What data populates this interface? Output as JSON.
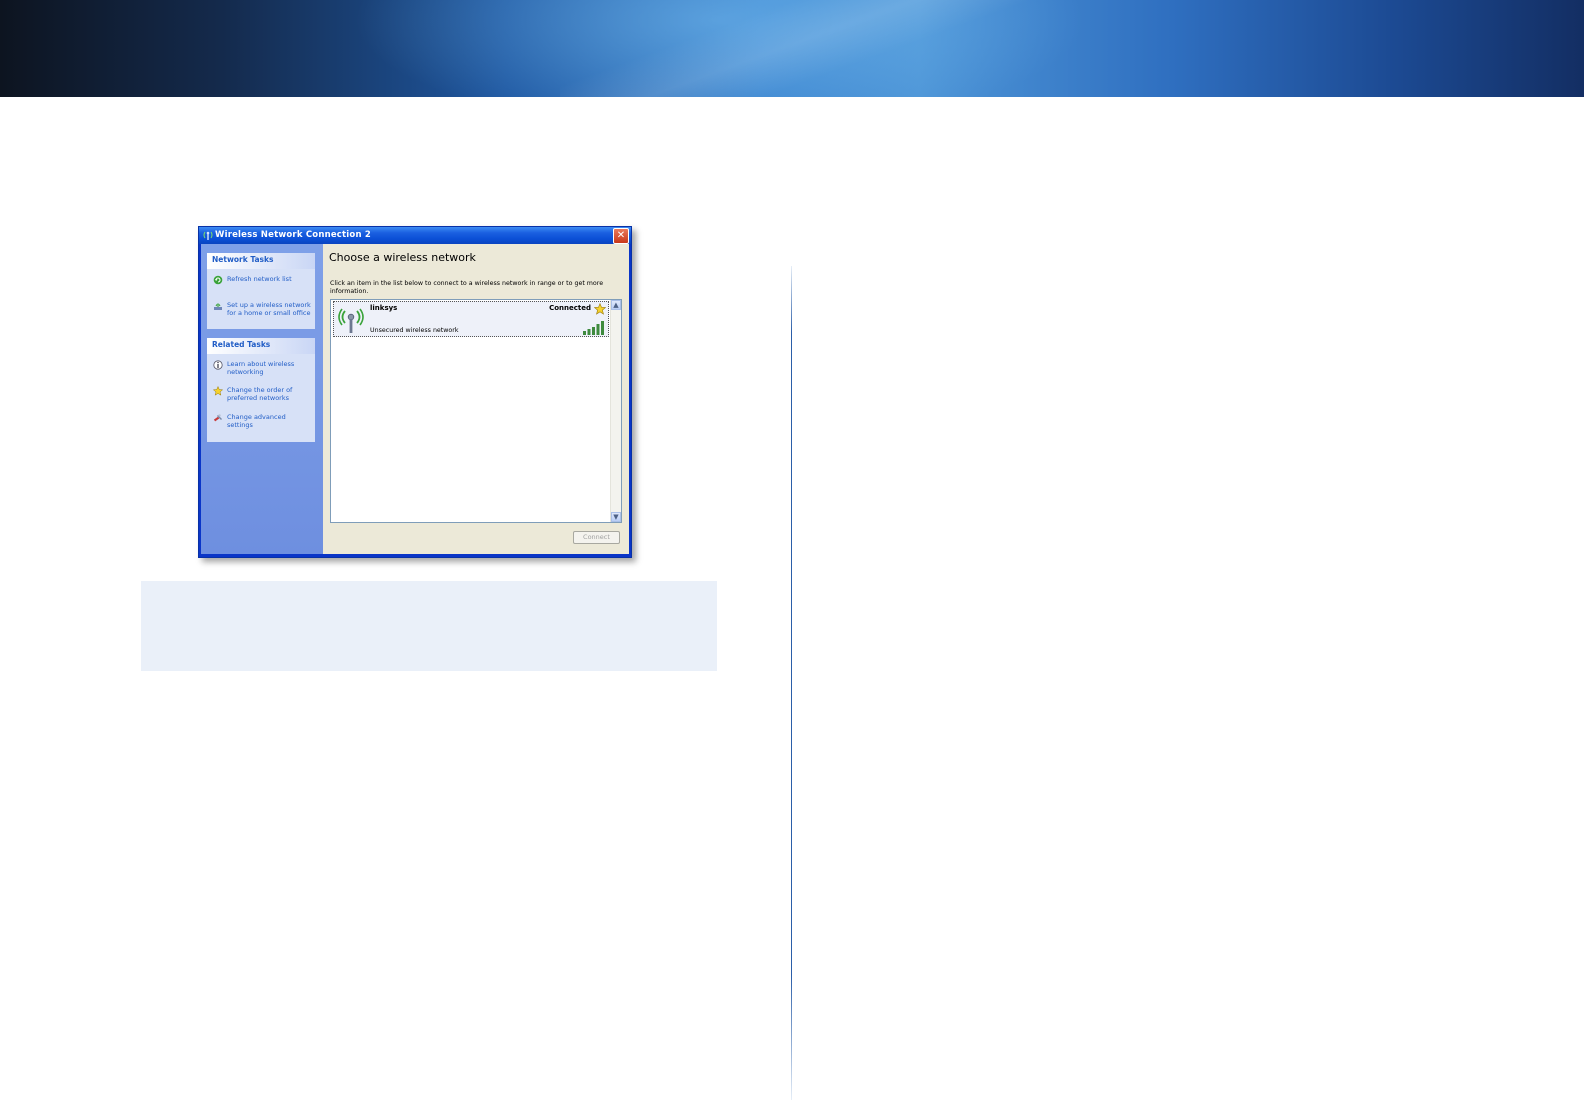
{
  "window": {
    "title": "Wireless Network Connection 2",
    "close_glyph": "✕"
  },
  "sidebar": {
    "network_tasks": {
      "heading": "Network Tasks",
      "items": [
        {
          "label": "Refresh network list",
          "icon": "refresh-icon"
        },
        {
          "label": "Set up a wireless network for a home or small office",
          "icon": "setup-network-icon"
        }
      ]
    },
    "related_tasks": {
      "heading": "Related Tasks",
      "items": [
        {
          "label": "Learn about wireless networking",
          "icon": "info-icon"
        },
        {
          "label": "Change the order of preferred networks",
          "icon": "star-icon"
        },
        {
          "label": "Change advanced settings",
          "icon": "settings-icon"
        }
      ]
    }
  },
  "main": {
    "heading": "Choose a wireless network",
    "instructions": "Click an item in the list below to connect to a wireless network in range or to get more information.",
    "networks": [
      {
        "name": "linksys",
        "status": "Connected",
        "security": "Unsecured wireless network",
        "signal_bars": 5
      }
    ],
    "connect_label": "Connect"
  },
  "colors": {
    "sidebar_link": "#215dc6",
    "titlebar": "#0b4fd6",
    "note_box": "#eaf0f9",
    "divider": "#2b5ea8"
  }
}
